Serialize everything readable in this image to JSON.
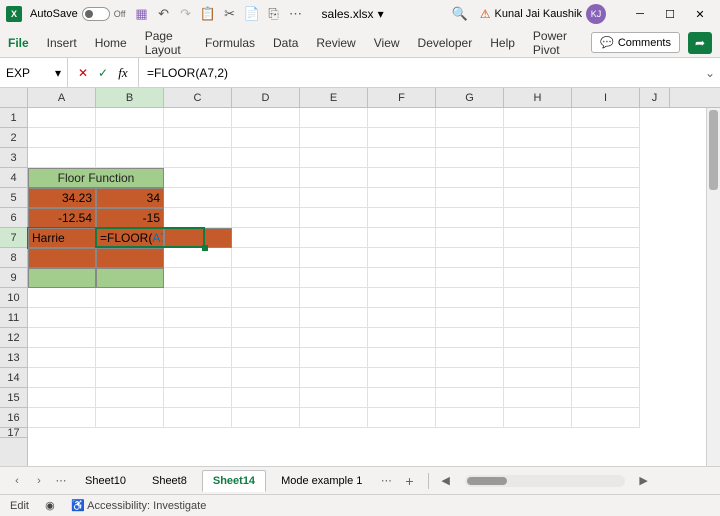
{
  "titlebar": {
    "autosave_label": "AutoSave",
    "autosave_state": "Off",
    "filename": "sales.xlsx",
    "user_name": "Kunal Jai Kaushik",
    "user_initials": "KJ"
  },
  "ribbon": {
    "file": "File",
    "tabs": [
      "Insert",
      "Home",
      "Page Layout",
      "Formulas",
      "Data",
      "Review",
      "View",
      "Developer",
      "Help",
      "Power Pivot"
    ],
    "comments": "Comments"
  },
  "formulabar": {
    "namebox": "EXP",
    "formula": "=FLOOR(A7,2)"
  },
  "columns": [
    "A",
    "B",
    "C",
    "D",
    "E",
    "F",
    "G",
    "H",
    "I",
    "J"
  ],
  "sheet": {
    "header": "Floor Function",
    "a5": "34.23",
    "b5": "34",
    "a6": "-12.54",
    "b6": "-15",
    "a7": "Harrie",
    "b7_prefix": "=FLOOR(",
    "b7_ref": "A7",
    "b7_suffix": ",2)"
  },
  "tabs": {
    "t1": "Sheet10",
    "t2": "Sheet8",
    "t3": "Sheet14",
    "t4": "Mode example 1"
  },
  "status": {
    "mode": "Edit",
    "acc": "Accessibility: Investigate"
  }
}
